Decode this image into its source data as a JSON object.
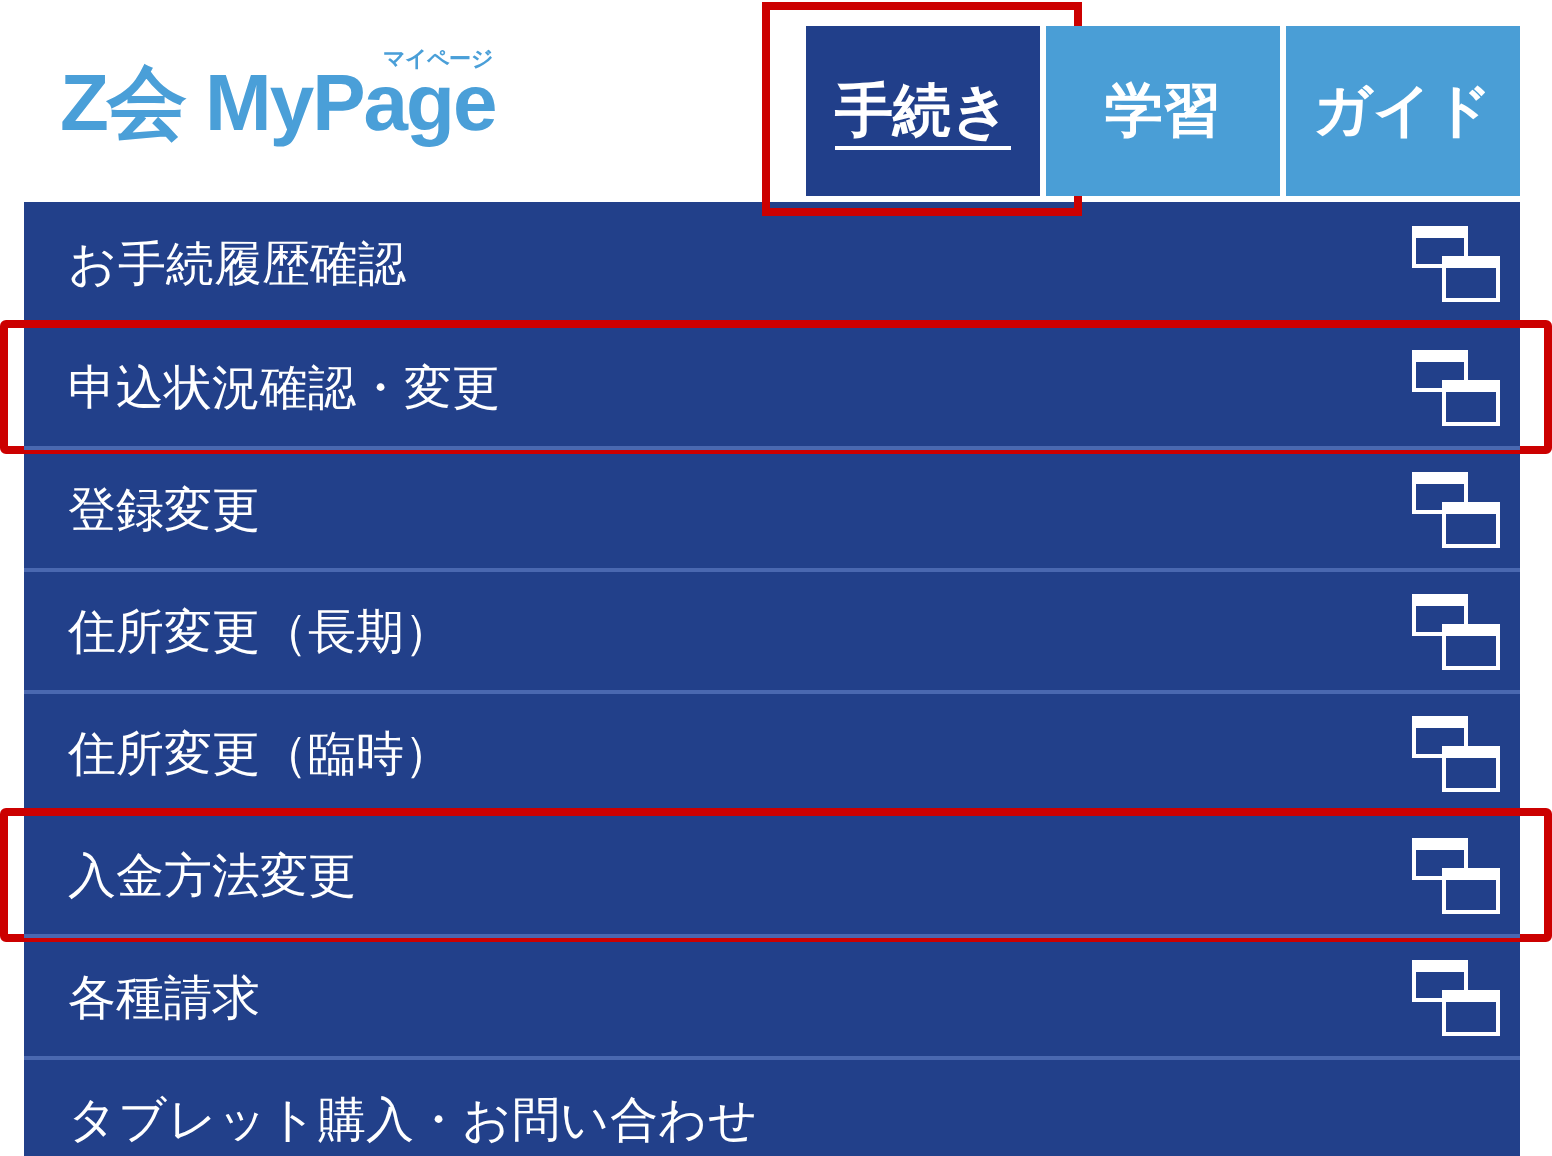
{
  "logo": {
    "brand": "Z会 MyPage",
    "subtitle": "マイページ"
  },
  "tabs": [
    {
      "label": "手続き",
      "selected": true,
      "highlighted": true
    },
    {
      "label": "学習",
      "selected": false,
      "highlighted": false
    },
    {
      "label": "ガイド",
      "selected": false,
      "highlighted": false
    }
  ],
  "menu": [
    {
      "label": "お手続履歴確認",
      "new_window": true,
      "highlighted": false
    },
    {
      "label": "申込状況確認・変更",
      "new_window": true,
      "highlighted": true
    },
    {
      "label": "登録変更",
      "new_window": true,
      "highlighted": false
    },
    {
      "label": "住所変更（長期）",
      "new_window": true,
      "highlighted": false
    },
    {
      "label": "住所変更（臨時）",
      "new_window": true,
      "highlighted": false
    },
    {
      "label": "入金方法変更",
      "new_window": true,
      "highlighted": true
    },
    {
      "label": "各種請求",
      "new_window": true,
      "highlighted": false
    },
    {
      "label": "タブレット購入・お問い合わせ",
      "new_window": false,
      "highlighted": false
    }
  ]
}
